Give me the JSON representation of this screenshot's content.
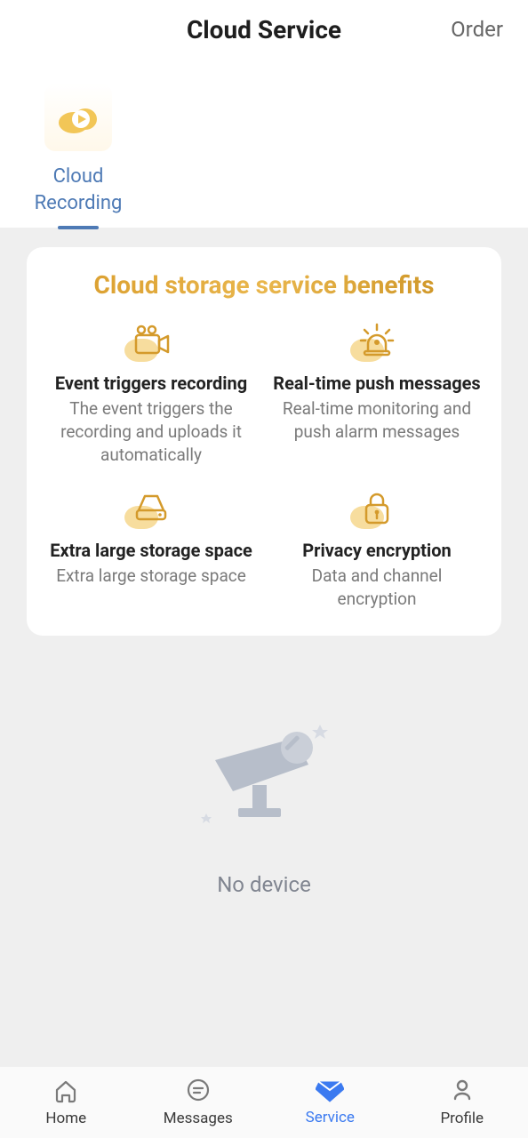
{
  "header": {
    "title": "Cloud Service",
    "order_label": "Order"
  },
  "tabs": [
    {
      "label": "Cloud\nRecording",
      "active": true
    }
  ],
  "card": {
    "title": "Cloud storage service benefits",
    "benefits": [
      {
        "icon": "camera-record-icon",
        "title": "Event triggers recording",
        "desc": "The event triggers the recording and uploads it automatically"
      },
      {
        "icon": "siren-icon",
        "title": "Real-time push messages",
        "desc": "Real-time monitoring and push alarm messages"
      },
      {
        "icon": "storage-drive-icon",
        "title": "Extra large storage space",
        "desc": "Extra large storage space"
      },
      {
        "icon": "lock-key-icon",
        "title": "Privacy encryption",
        "desc": "Data and channel encryption"
      }
    ]
  },
  "empty_state": {
    "label": "No device"
  },
  "nav": [
    {
      "label": "Home",
      "icon": "home-icon",
      "active": false
    },
    {
      "label": "Messages",
      "icon": "chat-icon",
      "active": false
    },
    {
      "label": "Service",
      "icon": "diamond-icon",
      "active": true
    },
    {
      "label": "Profile",
      "icon": "person-icon",
      "active": false
    }
  ],
  "colors": {
    "accent_blue": "#3b7af0",
    "tab_blue": "#4e7ab5",
    "gold_a": "#d89b2a",
    "icon_gold": "#d49a2b"
  }
}
